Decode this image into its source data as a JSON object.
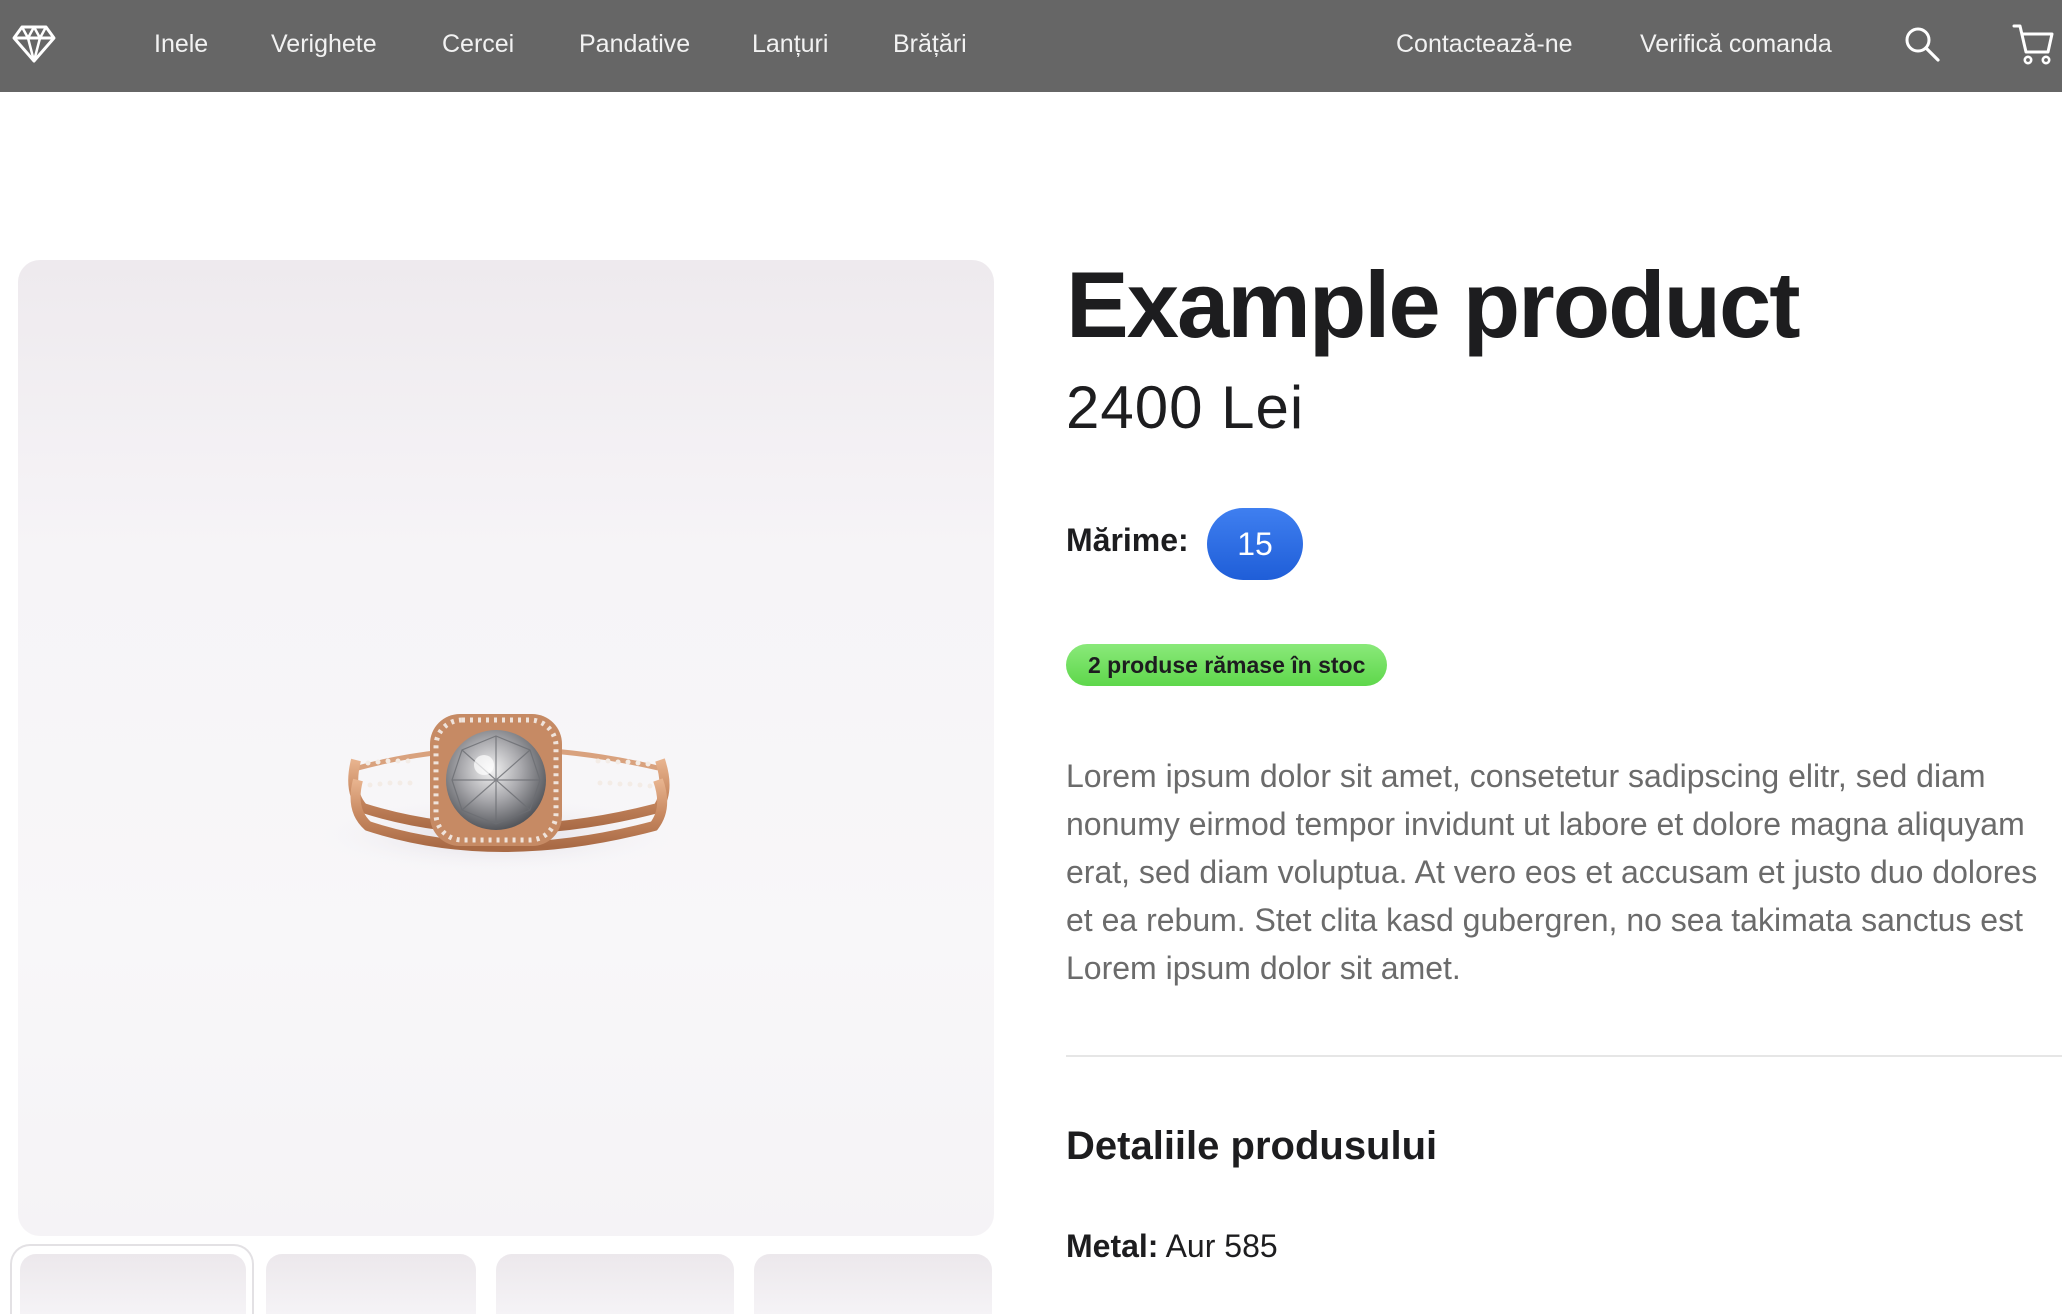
{
  "nav": {
    "logo_icon": "diamond-icon",
    "links": [
      "Inele",
      "Verighete",
      "Cercei",
      "Pandative",
      "Lanțuri",
      "Brățări"
    ],
    "contact_label": "Contactează-ne",
    "order_label": "Verifică comanda",
    "search_icon": "search-icon",
    "cart_icon": "cart-icon"
  },
  "gallery": {
    "main_image": "rose-gold-halo-diamond-ring",
    "thumbnail_count": 4
  },
  "product": {
    "title": "Example product",
    "price": "2400 Lei",
    "size_label": "Mărime:",
    "size_value": "15",
    "stock_text": "2 produse rămase în stoc",
    "description": "Lorem ipsum dolor sit amet, consetetur sadipscing elitr, sed diam nonumy eirmod tempor invidunt ut labore et dolore magna aliquyam erat, sed diam voluptua. At vero eos et accusam et justo duo dolores et ea rebum. Stet clita kasd gubergren, no sea takimata sanctus est Lorem ipsum dolor sit amet.",
    "details_heading": "Detaliile produsului",
    "specs": [
      {
        "key": "Metal:",
        "value": "Aur 585"
      }
    ]
  },
  "colors": {
    "nav_bg": "#666666",
    "size_pill": "#2f6fe6",
    "stock_badge": "#6ee05a",
    "description_text": "#6b6b6b"
  }
}
